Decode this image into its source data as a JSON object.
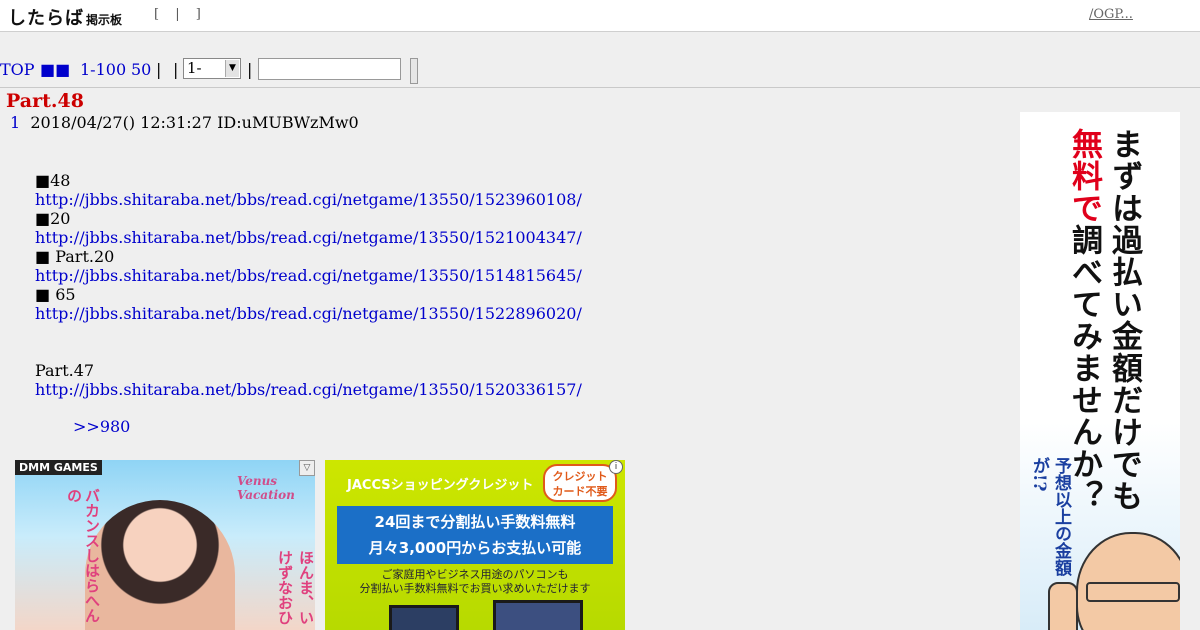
{
  "header": {
    "logo_main": "したらば",
    "logo_sub": "掲示板",
    "links": "[ | ]",
    "ogp_link": "/OGP..."
  },
  "nav": {
    "top": "TOP",
    "board": "■■",
    "range_1_100": "1-100",
    "latest_50": "50",
    "sep1": "|",
    "sep2": "|",
    "sep3": "|",
    "range_select_value": "1-",
    "search_value": ""
  },
  "thread": {
    "title": "Part.48",
    "post_number": "1",
    "post_meta": "2018/04/27() 12:31:27 ID:uMUBWzMw0",
    "lines": [
      {
        "text": "■48",
        "link": false
      },
      {
        "text": "http://jbbs.shitaraba.net/bbs/read.cgi/netgame/13550/1523960108/",
        "link": true
      },
      {
        "text": "■20",
        "link": false
      },
      {
        "text": "http://jbbs.shitaraba.net/bbs/read.cgi/netgame/13550/1521004347/",
        "link": true
      },
      {
        "text": "■ Part.20",
        "link": false
      },
      {
        "text": "http://jbbs.shitaraba.net/bbs/read.cgi/netgame/13550/1514815645/",
        "link": true
      },
      {
        "text": "■   65",
        "link": false
      },
      {
        "text": "http://jbbs.shitaraba.net/bbs/read.cgi/netgame/13550/1522896020/",
        "link": true
      },
      {
        "text": "",
        "link": false
      },
      {
        "text": "",
        "link": false
      },
      {
        "text": " Part.47",
        "link": false
      },
      {
        "text": "http://jbbs.shitaraba.net/bbs/read.cgi/netgame/13550/1520336157/",
        "link": true
      }
    ],
    "anchor": ">>980"
  },
  "ads": {
    "dmm": {
      "brand": "DMM GAMES",
      "game": "Venus Vacation",
      "copy": "バカンスしはらへんの",
      "copy2": "ほんま、いけずなおひ"
    },
    "jaccs": {
      "head": "JACCSショッピングクレジット",
      "bubble": "クレジット\nカード不要",
      "line1": "24回まで分割払い手数料無料",
      "line2": "月々3,000円からお支払い可能",
      "small1": "ご家庭用やビジネス用途のパソコンも",
      "small2": "分割払い手数料無料でお買い求めいただけます"
    },
    "side": {
      "main_before": "まずは過払い金額だけでも",
      "main_red": "無料で",
      "main_after": "調べてみませんか？",
      "sub": "予想以上の金額が!?"
    }
  }
}
